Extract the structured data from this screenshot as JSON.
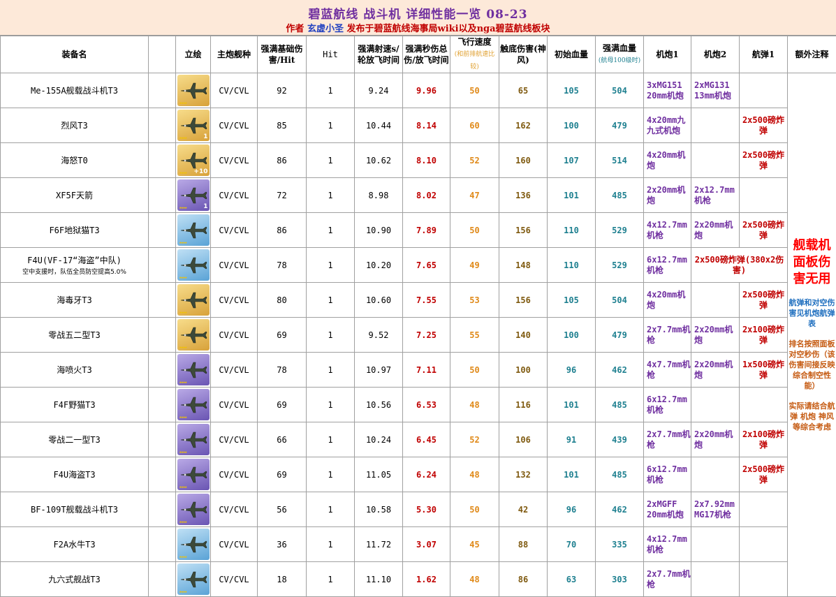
{
  "header": {
    "title": "碧蓝航线  战斗机  详细性能一览 08-23",
    "author_label": "作者",
    "author_name": "玄虚小圣",
    "publish_text": "发布于碧蓝航线海事局wiki以及nga碧蓝航线板块"
  },
  "columns": {
    "name": "装备名",
    "art": "立绘",
    "ship": "主炮舰种",
    "base_damage": "强满基础伤害/Hit",
    "hit": "Hit",
    "rate": "强满射速s/轮放飞时间",
    "dps": "强满秒伤总伤/放飞时间",
    "speed": "飞行速度",
    "speed_note": "(和前排航速比较)",
    "kamikaze": "触底伤害(神风)",
    "init_hp": "初始血量",
    "max_hp": "强满血量",
    "max_hp_note": "(航母100级时)",
    "gun1": "机炮1",
    "gun2": "机炮2",
    "bomb1": "航弹1",
    "extra": "额外注释"
  },
  "rows": [
    {
      "name": "Me-155A舰载战斗机T3",
      "rarity": "gold",
      "badge": "",
      "ship": "CV/CVL",
      "base": "92",
      "hit": "1",
      "rate": "9.24",
      "dps": "9.96",
      "speed": "50",
      "kami": "65",
      "init": "105",
      "max": "504",
      "g1": "3xMG151 20mm机炮",
      "g2": "2xMG131 13mm机炮",
      "b1": ""
    },
    {
      "name": "烈风T3",
      "rarity": "gold",
      "badge": "1",
      "ship": "CV/CVL",
      "base": "85",
      "hit": "1",
      "rate": "10.44",
      "dps": "8.14",
      "speed": "60",
      "kami": "162",
      "init": "100",
      "max": "479",
      "g1": "4x20mm九九式机炮",
      "g2": "",
      "b1": "2x500磅炸弹"
    },
    {
      "name": "海怒T0",
      "rarity": "gold",
      "badge": "+10",
      "ship": "CV/CVL",
      "base": "86",
      "hit": "1",
      "rate": "10.62",
      "dps": "8.10",
      "speed": "52",
      "kami": "160",
      "init": "107",
      "max": "514",
      "g1": "4x20mm机炮",
      "g2": "",
      "b1": "2x500磅炸弹"
    },
    {
      "name": "XF5F天箭",
      "rarity": "purple",
      "badge": "1",
      "ship": "CV/CVL",
      "base": "72",
      "hit": "1",
      "rate": "8.98",
      "dps": "8.02",
      "speed": "47",
      "kami": "136",
      "init": "101",
      "max": "485",
      "g1": "2x20mm机炮",
      "g2": "2x12.7mm机枪",
      "b1": ""
    },
    {
      "name": "F6F地狱猫T3",
      "rarity": "blue",
      "badge": "",
      "ship": "CV/CVL",
      "base": "86",
      "hit": "1",
      "rate": "10.90",
      "dps": "7.89",
      "speed": "50",
      "kami": "156",
      "init": "110",
      "max": "529",
      "g1": "4x12.7mm机枪",
      "g2": "2x20mm机炮",
      "b1": "2x500磅炸弹"
    },
    {
      "name": "F4U(VF-17“海盗”中队)",
      "note": "空中支援时，队伍全员防空提高5.0%",
      "rarity": "blue",
      "badge": "",
      "ship": "CV/CVL",
      "base": "78",
      "hit": "1",
      "rate": "10.20",
      "dps": "7.65",
      "speed": "49",
      "kami": "148",
      "init": "110",
      "max": "529",
      "g1": "6x12.7mm机枪",
      "g2": "2x500磅炸弹(380x2伤害)",
      "b1": ""
    },
    {
      "name": "海毒牙T3",
      "rarity": "gold",
      "badge": "",
      "ship": "CV/CVL",
      "base": "80",
      "hit": "1",
      "rate": "10.60",
      "dps": "7.55",
      "speed": "53",
      "kami": "156",
      "init": "105",
      "max": "504",
      "g1": "4x20mm机炮",
      "g2": "",
      "b1": "2x500磅炸弹"
    },
    {
      "name": "零战五二型T3",
      "rarity": "gold",
      "badge": "",
      "ship": "CV/CVL",
      "base": "69",
      "hit": "1",
      "rate": "9.52",
      "dps": "7.25",
      "speed": "55",
      "kami": "140",
      "init": "100",
      "max": "479",
      "g1": "2x7.7mm机枪",
      "g2": "2x20mm机炮",
      "b1": "2x100磅炸弹"
    },
    {
      "name": "海喷火T3",
      "rarity": "purple",
      "badge": "",
      "ship": "CV/CVL",
      "base": "78",
      "hit": "1",
      "rate": "10.97",
      "dps": "7.11",
      "speed": "50",
      "kami": "100",
      "init": "96",
      "max": "462",
      "g1": "4x7.7mm机枪",
      "g2": "2x20mm机炮",
      "b1": "1x500磅炸弹"
    },
    {
      "name": "F4F野猫T3",
      "rarity": "purple",
      "badge": "",
      "ship": "CV/CVL",
      "base": "69",
      "hit": "1",
      "rate": "10.56",
      "dps": "6.53",
      "speed": "48",
      "kami": "116",
      "init": "101",
      "max": "485",
      "g1": "6x12.7mm机枪",
      "g2": "",
      "b1": ""
    },
    {
      "name": "零战二一型T3",
      "rarity": "purple",
      "badge": "",
      "ship": "CV/CVL",
      "base": "66",
      "hit": "1",
      "rate": "10.24",
      "dps": "6.45",
      "speed": "52",
      "kami": "106",
      "init": "91",
      "max": "439",
      "g1": "2x7.7mm机枪",
      "g2": "2x20mm机炮",
      "b1": "2x100磅炸弹"
    },
    {
      "name": "F4U海盗T3",
      "rarity": "purple",
      "badge": "",
      "ship": "CV/CVL",
      "base": "69",
      "hit": "1",
      "rate": "11.05",
      "dps": "6.24",
      "speed": "48",
      "kami": "132",
      "init": "101",
      "max": "485",
      "g1": "6x12.7mm机枪",
      "g2": "",
      "b1": "2x500磅炸弹"
    },
    {
      "name": "BF-109T舰载战斗机T3",
      "rarity": "purple",
      "badge": "",
      "ship": "CV/CVL",
      "base": "56",
      "hit": "1",
      "rate": "10.58",
      "dps": "5.30",
      "speed": "50",
      "kami": "42",
      "init": "96",
      "max": "462",
      "g1": "2xMGFF 20mm机炮",
      "g2": "2x7.92mm MG17机枪",
      "b1": ""
    },
    {
      "name": "F2A水牛T3",
      "rarity": "blue",
      "badge": "",
      "ship": "CV/CVL",
      "base": "36",
      "hit": "1",
      "rate": "11.72",
      "dps": "3.07",
      "speed": "45",
      "kami": "88",
      "init": "70",
      "max": "335",
      "g1": "4x12.7mm机枪",
      "g2": "",
      "b1": ""
    },
    {
      "name": "九六式舰战T3",
      "rarity": "blue",
      "badge": "",
      "ship": "CV/CVL",
      "base": "18",
      "hit": "1",
      "rate": "11.10",
      "dps": "1.62",
      "speed": "48",
      "kami": "86",
      "init": "63",
      "max": "303",
      "g1": "2x7.7mm机枪",
      "g2": "",
      "b1": ""
    }
  ],
  "side_notes": {
    "big": "舰载机面板伤害无用",
    "s1": "航弹和对空伤害见机炮航弹表",
    "s2": "排名按照面板对空秒伤（该伤害间接反映综合制空性能）",
    "s3": "实际请结合航弹 机炮 神风等综合考虑"
  }
}
